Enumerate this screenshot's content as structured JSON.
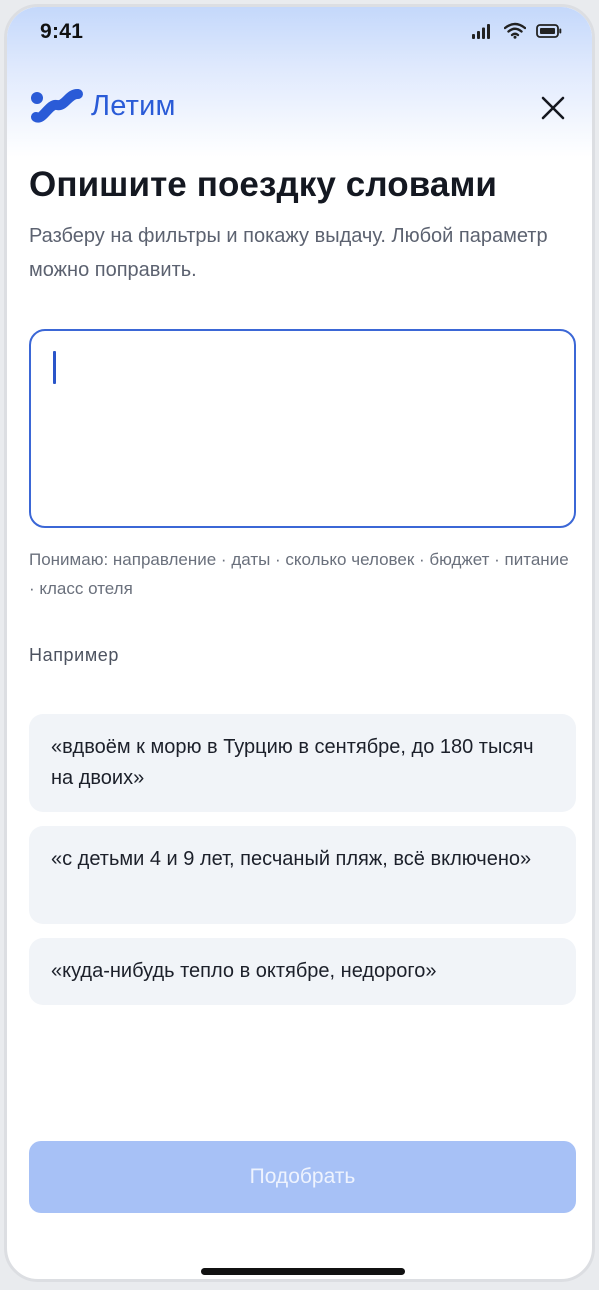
{
  "status_bar": {
    "time": "9:41",
    "icons": [
      "cellular-signal-icon",
      "wifi-icon",
      "battery-icon"
    ]
  },
  "header": {
    "logo_text": "Летим",
    "logo_icon": "letim-logo-icon",
    "close_icon": "close-icon"
  },
  "main": {
    "title": "Опишите поездку словами",
    "subtitle": "Разберу на фильтры и покажу выдачу. Любой параметр можно поправить.",
    "input": {
      "value": "",
      "placeholder": ""
    },
    "hint": "Понимаю: направление · даты · сколько человек · бюджет · питание · класс отеля",
    "examples_label": "Например",
    "examples": [
      "«вдвоём к морю в Турцию в сентябре, до 180 тысяч на двоих»",
      "«с детьми 4 и 9 лет, песчаный пляж, всё включено»",
      "«куда-нибудь тепло в октябре, недорого»"
    ]
  },
  "footer": {
    "submit_label": "Подобрать"
  },
  "colors": {
    "brand": "#2a5bd7",
    "input_border": "#3b67d6",
    "cta_disabled_bg": "#a7c1f6",
    "example_bg": "#f1f4f8"
  }
}
